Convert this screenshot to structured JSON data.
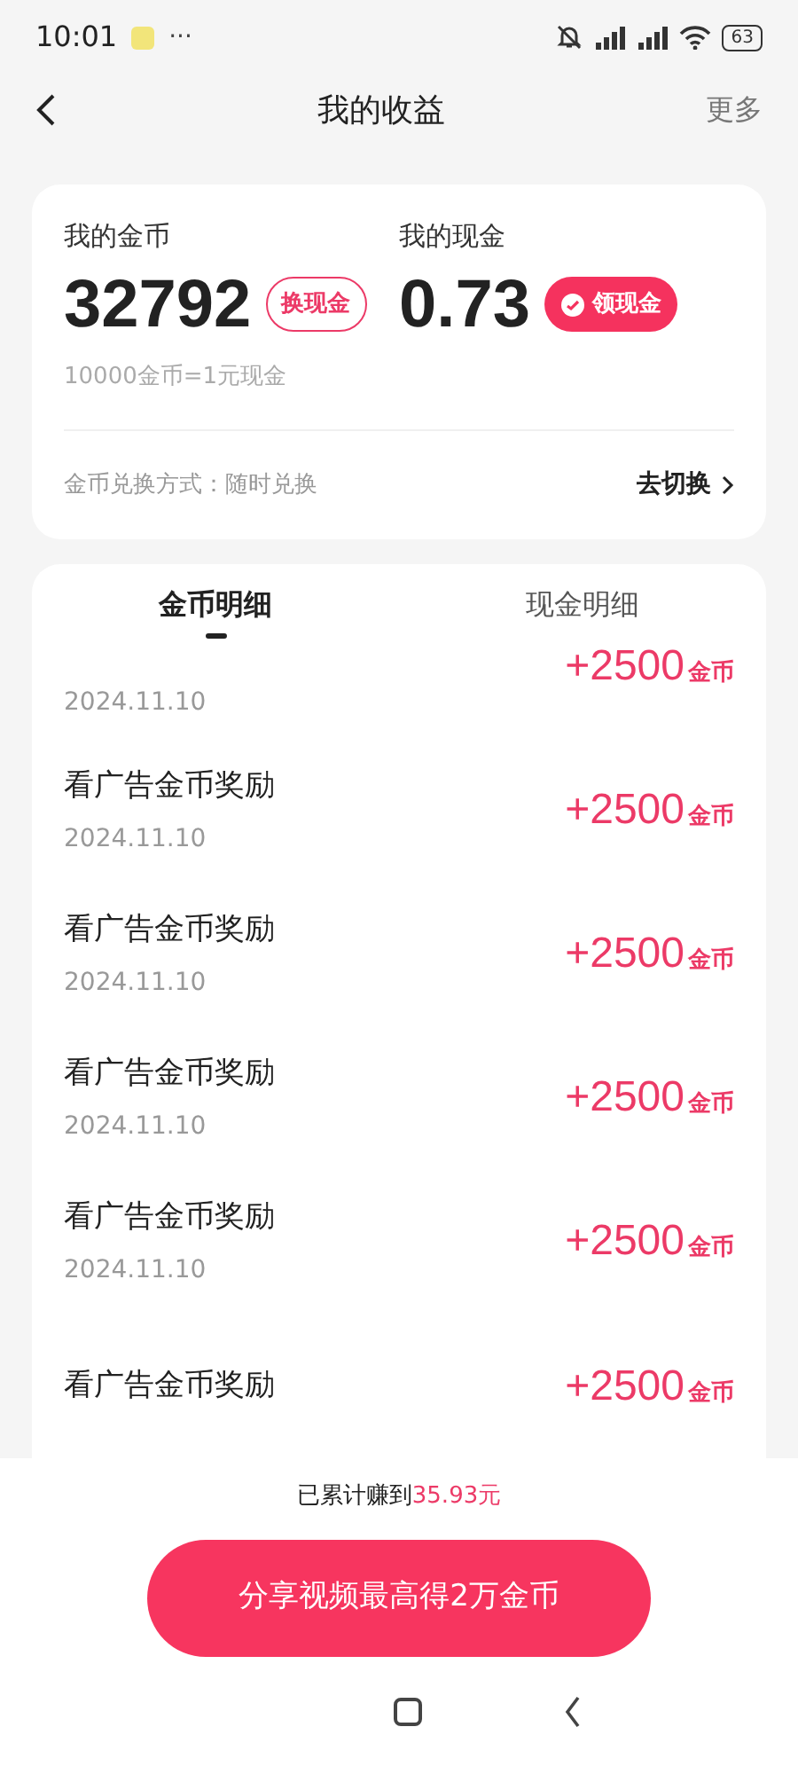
{
  "status_bar": {
    "time": "10:01",
    "more": "···",
    "battery": "63"
  },
  "header": {
    "title": "我的收益",
    "action": "更多"
  },
  "summary": {
    "coins": {
      "label": "我的金币",
      "value": "32792",
      "button": "换现金"
    },
    "cash": {
      "label": "我的现金",
      "value": "0.73",
      "button": "领现金"
    },
    "rate": "10000金币=1元现金",
    "exchange_mode": "金币兑换方式：随时兑换",
    "switch_link": "去切换"
  },
  "tabs": [
    {
      "label": "金币明细",
      "selected": true
    },
    {
      "label": "现金明细",
      "selected": false
    }
  ],
  "records": [
    {
      "date": "2024.11.10",
      "amount": "+2500",
      "unit": "金币"
    },
    {
      "title": "看广告金币奖励",
      "date": "2024.11.10",
      "amount": "+2500",
      "unit": "金币"
    },
    {
      "title": "看广告金币奖励",
      "date": "2024.11.10",
      "amount": "+2500",
      "unit": "金币"
    },
    {
      "title": "看广告金币奖励",
      "date": "2024.11.10",
      "amount": "+2500",
      "unit": "金币"
    },
    {
      "title": "看广告金币奖励",
      "date": "2024.11.10",
      "amount": "+2500",
      "unit": "金币"
    },
    {
      "title": "看广告金币奖励",
      "amount": "+2500",
      "unit": "金币"
    }
  ],
  "footer": {
    "total": "已累计赚到**35.93元**",
    "share_button": "分享视频最高得2万金币"
  }
}
